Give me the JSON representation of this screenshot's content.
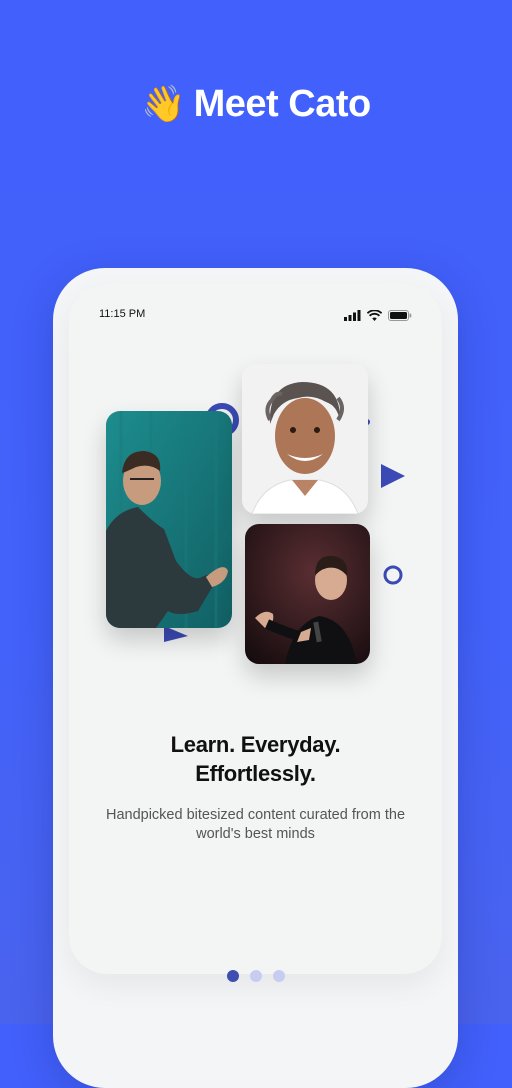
{
  "header": {
    "emoji": "👋",
    "title": "Meet Cato"
  },
  "status_bar": {
    "time": "11:15 PM",
    "icons": [
      "signal-icon",
      "wifi-icon",
      "battery-icon"
    ]
  },
  "hero_images": [
    {
      "name": "speaker-photo-left",
      "description": "speaker-teal-background"
    },
    {
      "name": "speaker-photo-top-right",
      "description": "speaker-white-background"
    },
    {
      "name": "speaker-photo-bottom-right",
      "description": "speaker-dark-stage"
    }
  ],
  "content": {
    "headline_line1": "Learn. Everyday.",
    "headline_line2": "Effortlessly.",
    "subtext_line1": "Handpicked bitesized content curated from the",
    "subtext_line2": "world's best minds"
  },
  "pagination": {
    "total": 3,
    "active_index": 0
  },
  "colors": {
    "background": "#4260fb",
    "accent": "#3e4fb1",
    "inactive_dot": "#c7cdf1",
    "phone_body": "#f4f5f6"
  }
}
